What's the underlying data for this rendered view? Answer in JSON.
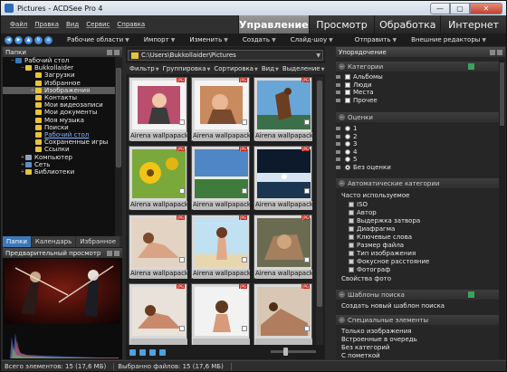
{
  "window": {
    "title": "Pictures - ACDSee Pro 4",
    "min_label": "—",
    "max_label": "▢",
    "close_label": "✕"
  },
  "menu": [
    "Файл",
    "Правка",
    "Вид",
    "Сервис",
    "Справка"
  ],
  "mode_tabs": [
    "Управление",
    "Просмотр",
    "Обработка",
    "Интернет"
  ],
  "toolbar": {
    "items": [
      "Рабочие области",
      "Импорт",
      "Изменить",
      "Создать",
      "Слайд-шоу",
      "Отправить",
      "Внешние редакторы"
    ]
  },
  "folders_panel": {
    "title": "Папки",
    "tree": [
      {
        "label": "Рабочий стол",
        "level": 0,
        "toggle": "−"
      },
      {
        "label": "Bukkollaider",
        "level": 1,
        "toggle": "−"
      },
      {
        "label": "Загрузки",
        "level": 2,
        "toggle": ""
      },
      {
        "label": "Избранное",
        "level": 2,
        "toggle": ""
      },
      {
        "label": "Изображения",
        "level": 2,
        "toggle": "+"
      },
      {
        "label": "Контакты",
        "level": 2,
        "toggle": ""
      },
      {
        "label": "Мои видеозаписи",
        "level": 2,
        "toggle": ""
      },
      {
        "label": "Мои документы",
        "level": 2,
        "toggle": ""
      },
      {
        "label": "Моя музыка",
        "level": 2,
        "toggle": ""
      },
      {
        "label": "Поиски",
        "level": 2,
        "toggle": ""
      },
      {
        "label": "Рабочий стол",
        "level": 2,
        "toggle": ""
      },
      {
        "label": "Сохраненные игры",
        "level": 2,
        "toggle": ""
      },
      {
        "label": "Ссылки",
        "level": 2,
        "toggle": ""
      },
      {
        "label": "Компьютер",
        "level": 1,
        "toggle": "+"
      },
      {
        "label": "Сеть",
        "level": 1,
        "toggle": "+"
      },
      {
        "label": "Библиотеки",
        "level": 1,
        "toggle": "+"
      }
    ],
    "selected_index": 4,
    "link_index": 10
  },
  "left_tabs": [
    "Папки",
    "Календарь",
    "Избранное"
  ],
  "preview_panel": {
    "title": "Предварительный просмотр"
  },
  "path": "C:\\Users\\Bukkollaider\\Pictures",
  "filter_bar": [
    "Фильтр",
    "Группировка",
    "Сортировка",
    "Вид",
    "Выделение"
  ],
  "thumbnails": [
    {
      "caption": "Airena wallpapack 21...",
      "badge": "JPG"
    },
    {
      "caption": "Airena wallpapack 21...",
      "badge": "JPG"
    },
    {
      "caption": "Airena wallpapack 21...",
      "badge": "JPG"
    },
    {
      "caption": "Airena wallpapack 21...",
      "badge": "JPG"
    },
    {
      "caption": "Airena wallpapack 21...",
      "badge": "JPG"
    },
    {
      "caption": "Airena wallpapack 21...",
      "badge": "JPG"
    },
    {
      "caption": "Airena wallpapack 21...",
      "badge": "JPG"
    },
    {
      "caption": "Airena wallpapack 21...",
      "badge": "JPG"
    },
    {
      "caption": "Airena wallpapack 21...",
      "badge": "JPG"
    },
    {
      "caption": "",
      "badge": "JPG"
    },
    {
      "caption": "",
      "badge": "JPG"
    },
    {
      "caption": "",
      "badge": "JPG"
    }
  ],
  "organize_panel": {
    "title": "Упорядочение",
    "categories_title": "Категории",
    "categories": [
      "Альбомы",
      "Люди",
      "Места",
      "Прочее"
    ],
    "ratings_title": "Оценки",
    "ratings": [
      "1",
      "2",
      "3",
      "4",
      "5",
      "Без оценки"
    ],
    "ratings_selected": 5,
    "auto_title": "Автоматические категории",
    "auto_head": "Часто используемое",
    "auto_items": [
      "ISO",
      "Автор",
      "Выдержка затвора",
      "Диафрагма",
      "Ключевые слова",
      "Размер файла",
      "Тип изображения",
      "Фокусное расстояние",
      "Фотограф"
    ],
    "auto_tail": "Свойства фото",
    "search_title": "Шаблоны поиска",
    "search_item": "Создать новый шаблон поиска",
    "special_title": "Специальные элементы",
    "special_items": [
      "Только изображения",
      "Встроенные в очередь",
      "Без категорий",
      "С пометкой"
    ]
  },
  "status": {
    "total": "Всего элементов: 15  (17,6 МБ)",
    "selected": "Выбранно файлов: 15  (17,6 МБ)"
  },
  "colors": {
    "accent_blue": "#3c78b9",
    "active_tab": "#7a7a7a",
    "jpg_badge": "#c0281e",
    "folder": "#e6c33a"
  }
}
